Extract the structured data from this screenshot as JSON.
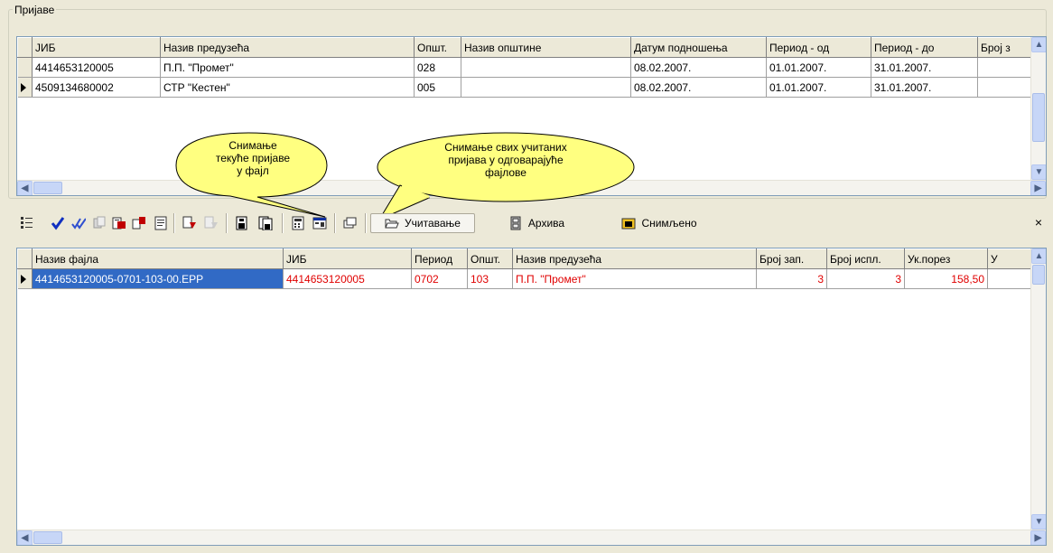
{
  "group_title": "Пријаве",
  "top_grid": {
    "columns": [
      "ЈИБ",
      "Назив предузећа",
      "Општ.",
      "Назив општине",
      "Датум подношења",
      "Период - од",
      "Период - до",
      "Број з"
    ],
    "rows": [
      {
        "jib": "4414653120005",
        "naziv": "П.П. \"Промет\"",
        "opst": "028",
        "naziv_opst": "",
        "datum": "08.02.2007.",
        "od": "01.01.2007.",
        "do": "31.01.2007.",
        "broj": ""
      },
      {
        "jib": "4509134680002",
        "naziv": "СТР \"Кестен\"",
        "opst": "005",
        "naziv_opst": "",
        "datum": "08.02.2007.",
        "od": "01.01.2007.",
        "do": "31.01.2007.",
        "broj": ""
      }
    ],
    "current_row": 1
  },
  "callouts": {
    "left": "Снимање\nтекуће пријаве\nу фајл",
    "right": "Снимање свих учитаних\nпријава у одговарајуће\nфајлове"
  },
  "toolbar": {
    "load_label": "Учитавање",
    "archive_label": "Архива",
    "saved_label": "Снимљено",
    "close_symbol": "×"
  },
  "bottom_grid": {
    "columns": [
      "Назив фајла",
      "ЈИБ",
      "Период",
      "Општ.",
      "Назив предузећа",
      "Број зап.",
      "Број испл.",
      "Ук.порез",
      "У"
    ],
    "rows": [
      {
        "file": "4414653120005-0701-103-00.EPP",
        "jib": "4414653120005",
        "period": "0702",
        "opst": "103",
        "naziv": "П.П. \"Промет\"",
        "broj_zap": "3",
        "broj_ispl": "3",
        "uk_porez": "158,50",
        "u": ""
      }
    ]
  },
  "colors": {
    "window_bg": "#ece9d8",
    "callout_fill": "#ffff80",
    "selection": "#316ac5",
    "red_text": "#e00000"
  }
}
